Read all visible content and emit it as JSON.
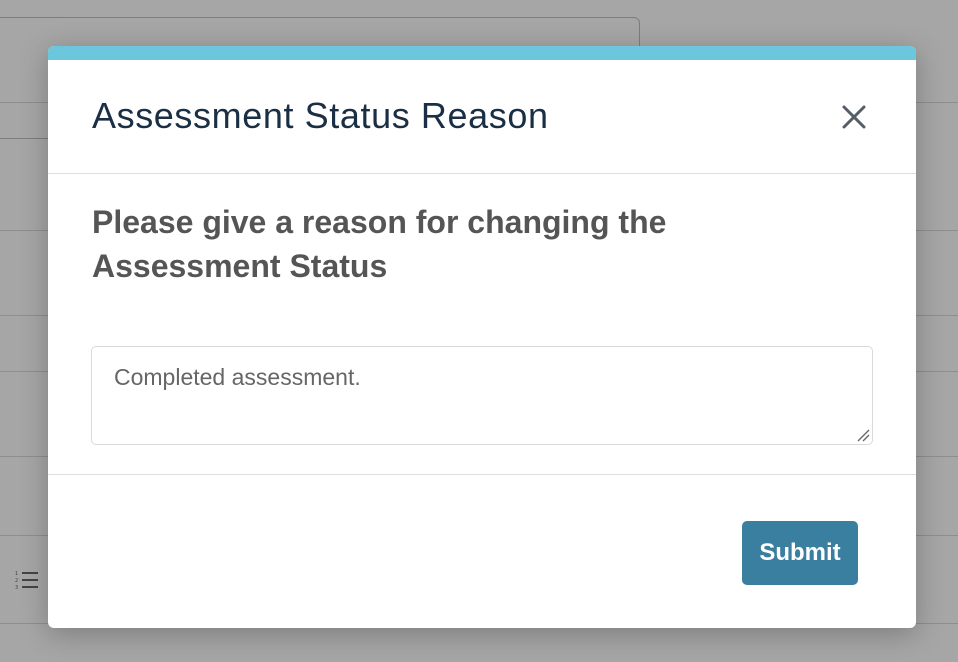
{
  "modal": {
    "title": "Assessment Status Reason",
    "prompt": "Please give a reason for changing the Assessment Status",
    "reason_value": "Completed assessment.",
    "submit_label": "Submit",
    "close_icon": "close-icon",
    "accent_color": "#6cc7dd",
    "submit_color": "#3b7fa0",
    "title_color": "#1a2e44"
  },
  "background": {
    "list_icon": "numbered-list-icon"
  }
}
